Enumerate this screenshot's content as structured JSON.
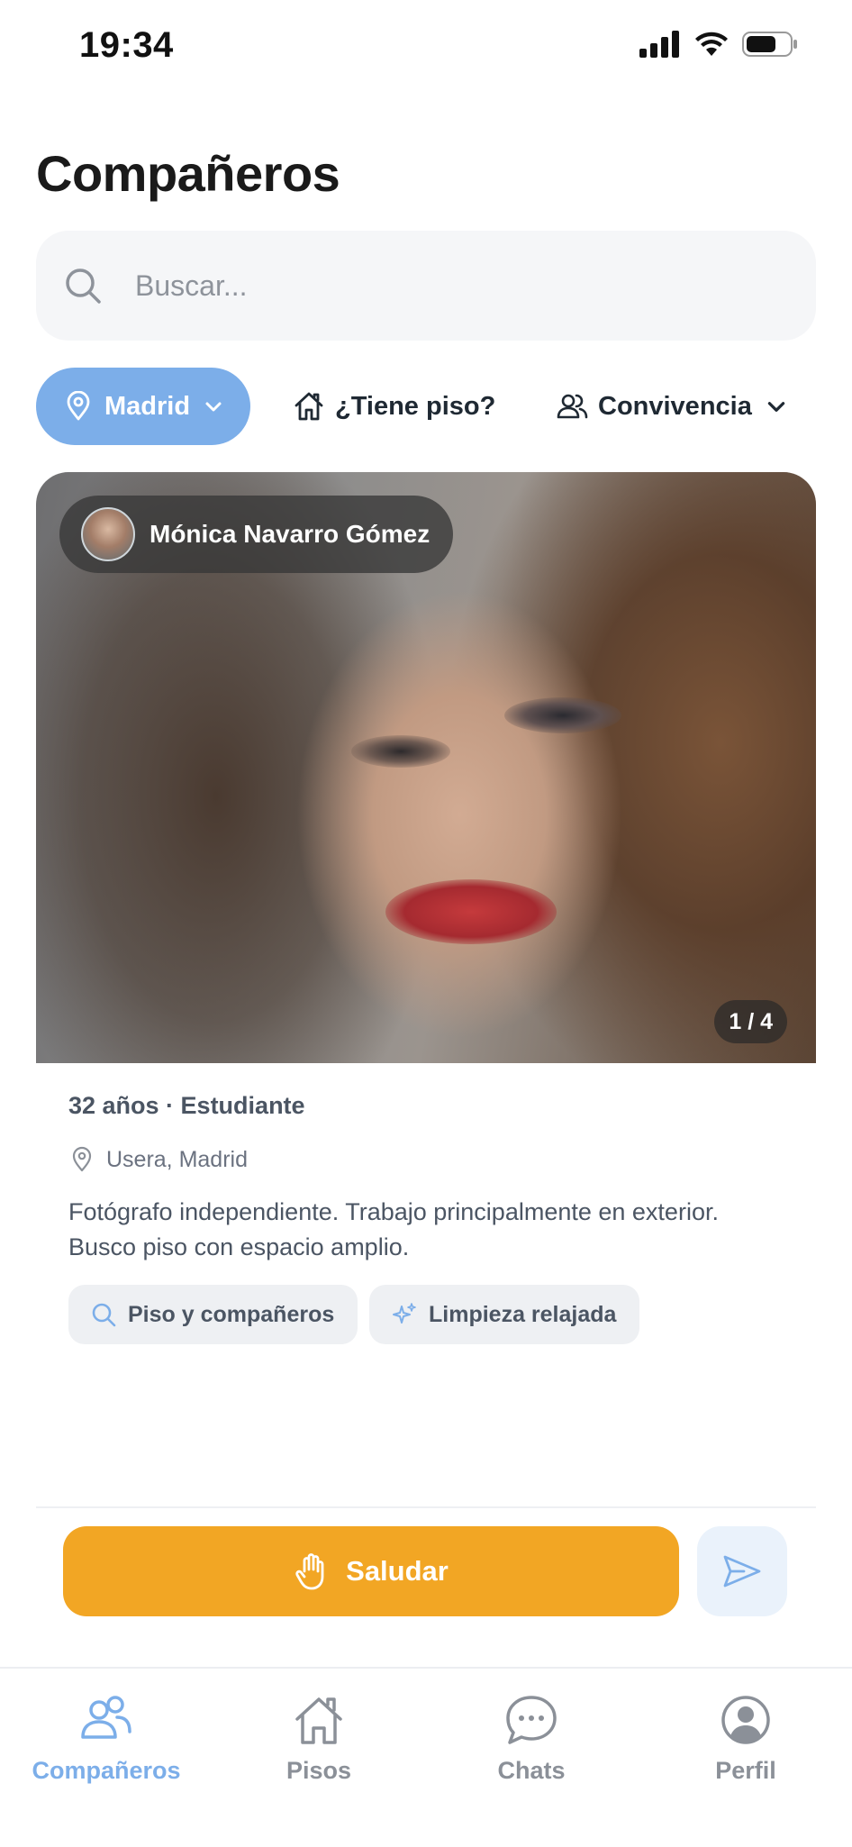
{
  "status_bar": {
    "time": "19:34"
  },
  "header": {
    "title": "Compañeros"
  },
  "search": {
    "placeholder": "Buscar..."
  },
  "filters": [
    {
      "label": "Madrid",
      "active": true
    },
    {
      "label": "¿Tiene piso?"
    },
    {
      "label": "Convivencia"
    }
  ],
  "card": {
    "name": "Mónica Navarro Gómez",
    "photo_counter": "1 / 4",
    "meta": "32 años · Estudiante",
    "location": "Usera, Madrid",
    "description": "Fotógrafo independiente. Trabajo principalmente en exterior. Busco piso con espacio amplio.",
    "tags": [
      {
        "label": "Piso y compañeros",
        "icon": "search-icon"
      },
      {
        "label": "Limpieza relajada",
        "icon": "sparkles-icon"
      }
    ]
  },
  "actions": {
    "greet_label": "Saludar"
  },
  "tabbar": [
    {
      "label": "Compañeros",
      "icon": "users-icon",
      "active": true
    },
    {
      "label": "Pisos",
      "icon": "home-icon"
    },
    {
      "label": "Chats",
      "icon": "chat-icon"
    },
    {
      "label": "Perfil",
      "icon": "profile-icon"
    }
  ],
  "colors": {
    "accent": "#7caee9",
    "primary_button": "#f2a624",
    "text": "#111827",
    "muted": "#6b7280"
  }
}
